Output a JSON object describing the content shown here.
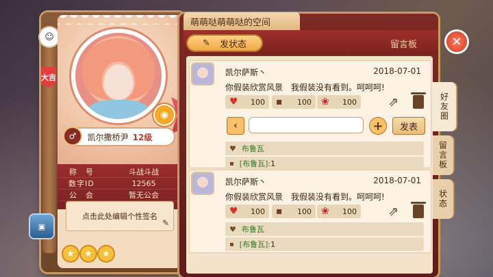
{
  "profile": {
    "player_name": "凯尔撒桥尹",
    "level": "12级",
    "camera_icon": "camera-icon",
    "rank_tag": "大吉",
    "info_rows": [
      {
        "key": "称　号",
        "value": "斗战斗战"
      },
      {
        "key": "数字ID",
        "value": "12565"
      },
      {
        "key": "公　会",
        "value": "暂无公会"
      }
    ],
    "signature_placeholder": "点击此处编辑个性签名",
    "stars": 3
  },
  "board": {
    "space_title": "萌萌哒萌萌哒的空间",
    "post_button": "发状态",
    "section_label": "留言板",
    "side_tabs": [
      "好友圈",
      "留言板",
      "状态"
    ]
  },
  "posts": [
    {
      "author": "凯尔萨斯丶",
      "date": "2018-07-01",
      "text": "你假装欣赏风景　我假装没有看到。呵呵呵!",
      "likes": "100",
      "comments": "100",
      "roses": "100",
      "liked_by": "布鲁瓦",
      "comment_author": "[布鲁瓦]:",
      "comment_text": "1",
      "reply_send_label": "发表"
    },
    {
      "author": "凯尔萨斯丶",
      "date": "2018-07-01",
      "text": "你假装欣赏风景　我假装没有看到。呵呵呵!",
      "likes": "100",
      "comments": "100",
      "roses": "100",
      "liked_by": "布鲁瓦",
      "comment_author": "[布鲁瓦]:",
      "comment_text": "1"
    }
  ],
  "colors": {
    "accent_red": "#7c2220",
    "gold": "#f0a440",
    "parchment": "#f4e3c8"
  }
}
